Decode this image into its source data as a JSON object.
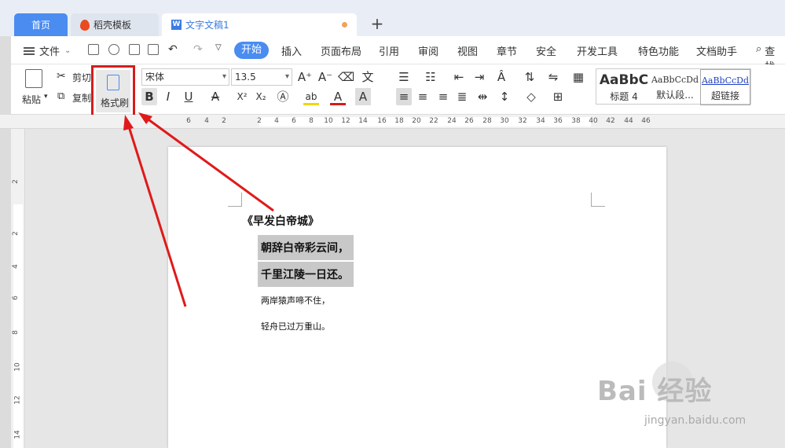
{
  "tabs": {
    "home": "首页",
    "template": "稻壳模板",
    "doc": "文字文稿1"
  },
  "menu": {
    "file": "文件",
    "items": [
      "开始",
      "插入",
      "页面布局",
      "引用",
      "审阅",
      "视图",
      "章节",
      "安全",
      "开发工具",
      "特色功能",
      "文档助手"
    ],
    "search": "查找"
  },
  "ribbon": {
    "paste": "粘贴",
    "cut": "剪切",
    "copy": "复制",
    "format_painter": "格式刷",
    "font_name": "宋体",
    "font_size": "13.5"
  },
  "styles": [
    {
      "sample": "AaBbC",
      "name": "标题 4"
    },
    {
      "sample": "AaBbCcDd",
      "name": "默认段..."
    },
    {
      "sample": "AaBbCcDd",
      "name": "超链接"
    }
  ],
  "ruler_top": [
    "6",
    "4",
    "2",
    "2",
    "4",
    "6",
    "8",
    "10",
    "12",
    "14",
    "16",
    "18",
    "20",
    "22",
    "24",
    "26",
    "28",
    "30",
    "32",
    "34",
    "36",
    "38",
    "40",
    "42",
    "44",
    "46"
  ],
  "ruler_left": [
    "2",
    "2",
    "4",
    "6",
    "8",
    "10",
    "12",
    "14"
  ],
  "document": {
    "title": "《早发白帝城》",
    "lines": [
      "朝辞白帝彩云间，",
      "千里江陵一日还。",
      "两岸猿声啼不住，",
      "轻舟已过万重山。"
    ]
  },
  "watermark": {
    "brand": "Bai 经验",
    "url": "jingyan.baidu.com"
  },
  "colors": {
    "accent": "#4a8cf0",
    "annotation": "#d41c1c"
  }
}
